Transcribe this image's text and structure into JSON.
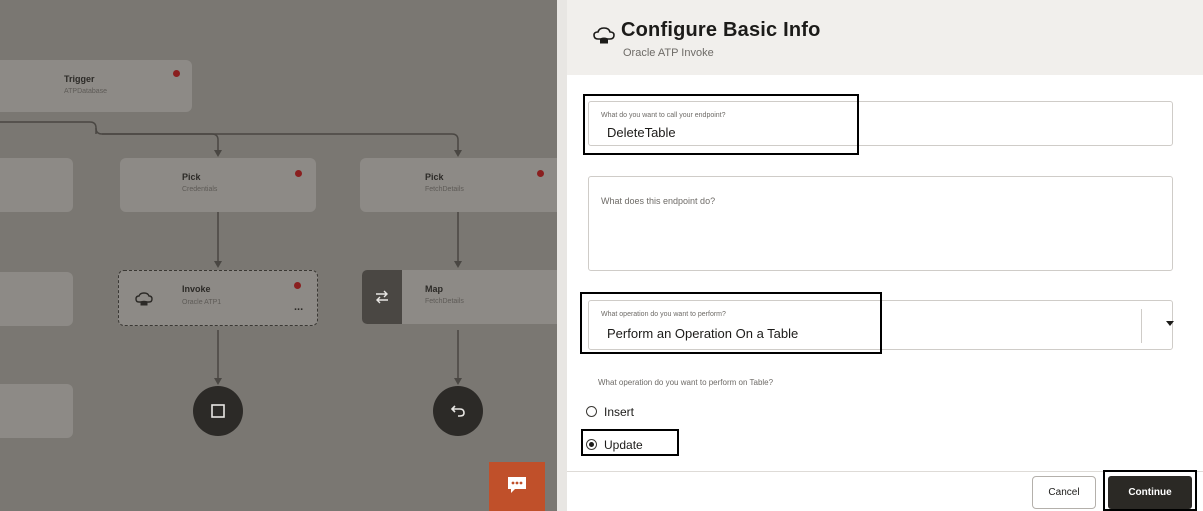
{
  "canvas": {
    "trigger": {
      "title": "Trigger",
      "subtitle": "ATPDatabase"
    },
    "pick_left": {
      "title": "Pick",
      "subtitle": "Credentials"
    },
    "pick_right": {
      "title": "Pick",
      "subtitle": "FetchDetails"
    },
    "invoke": {
      "title": "Invoke",
      "subtitle": "Oracle ATP1",
      "more": "..."
    },
    "map": {
      "title": "Map",
      "subtitle": "FetchDetails"
    },
    "chat": {
      "icon": "chat-bubble-icon"
    }
  },
  "panel": {
    "title": "Configure Basic Info",
    "subtitle": "Oracle ATP Invoke",
    "endpoint_name": {
      "label": "What do you want to call your endpoint?",
      "value": "DeleteTable"
    },
    "endpoint_description": {
      "placeholder": "What does this endpoint do?"
    },
    "operation": {
      "label": "What operation do you want to perform?",
      "value": "Perform an Operation On a Table"
    },
    "table_operation": {
      "question": "What operation do you want to perform on Table?",
      "options": [
        "Insert",
        "Update"
      ],
      "selected": "Update"
    },
    "buttons": {
      "cancel": "Cancel",
      "continue": "Continue"
    }
  },
  "colors": {
    "canvas_overlay": "#7a7772",
    "primary_button": "#2b2925",
    "chat_accent": "#c0502a"
  }
}
